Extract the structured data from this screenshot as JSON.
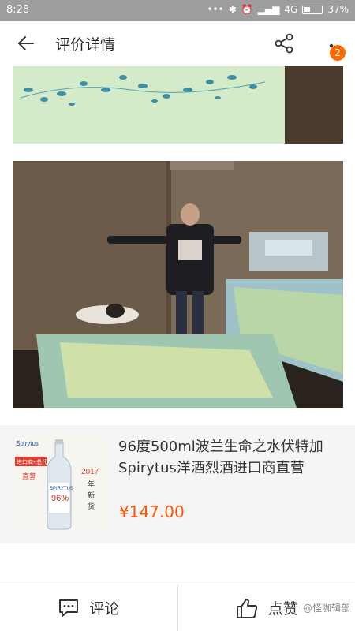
{
  "status_bar": {
    "time": "8:28",
    "network": "4G",
    "battery": "37%",
    "icons": [
      "dots-icon",
      "bluetooth-icon",
      "alarm-icon",
      "signal-icon",
      "battery-icon"
    ]
  },
  "header": {
    "title": "评价详情",
    "badge_count": "2",
    "icons": [
      "back-arrow-icon",
      "share-icon",
      "more-vertical-icon"
    ]
  },
  "product": {
    "name": "96度500ml波兰生命之水伏特加Spirytus洋酒烈酒进口商直营",
    "price": "¥147.00",
    "thumb_brand": "SPIRYTUS",
    "thumb_badge": "进口商+总代",
    "thumb_badge2": "直营",
    "thumb_year": "2017",
    "thumb_year_text": "年新货",
    "thumb_percent": "96%"
  },
  "bottom_bar": {
    "comment_label": "评论",
    "like_label": "点赞",
    "icons": [
      "comment-icon",
      "thumbs-up-icon"
    ]
  },
  "watermark": "@怪咖辑部"
}
